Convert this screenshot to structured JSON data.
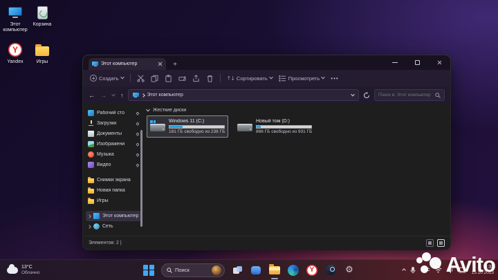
{
  "desktop": {
    "icons": [
      {
        "label": "Этот компьютер"
      },
      {
        "label": "Корзина"
      },
      {
        "label": "Yandex"
      },
      {
        "label": "Игры"
      }
    ]
  },
  "window": {
    "tab": {
      "title": "Этот компьютер"
    },
    "toolbar": {
      "new_label": "Создать",
      "sort_label": "Сортировать",
      "view_label": "Просмотреть",
      "more_label": "•••",
      "sort_glyph": "↑↓"
    },
    "address": {
      "breadcrumb": "Этот компьютер",
      "search_placeholder": "Поиск в: Этот компьютер"
    },
    "sidebar": {
      "pinned": [
        {
          "label": "Рабочий сто"
        },
        {
          "label": "Загрузки"
        },
        {
          "label": "Документы"
        },
        {
          "label": "Изображени"
        },
        {
          "label": "Музыка"
        },
        {
          "label": "Видео"
        }
      ],
      "folders": [
        {
          "label": "Снимки экрана"
        },
        {
          "label": "Новая папка"
        },
        {
          "label": "Игры"
        }
      ],
      "tree": [
        {
          "label": "Этот компьютер"
        },
        {
          "label": "Сеть"
        }
      ]
    },
    "content": {
      "group_label": "Жесткие диски",
      "drives": [
        {
          "name": "Windows 11 (C:)",
          "caption": "181 ГБ свободно из 238 ГБ",
          "used_pct": 24
        },
        {
          "name": "Новый том (D:)",
          "caption": "866 ГБ свободно из 931 ГБ",
          "used_pct": 7
        }
      ]
    },
    "statusbar": {
      "items_label": "Элементов: 2  |"
    }
  },
  "taskbar": {
    "weather": {
      "temp": "13°C",
      "condition": "Облачно"
    },
    "search_label": "Поиск",
    "yandex_letter": "Y",
    "tray": {
      "lang": "РУС",
      "time": "9:33",
      "date": "15.10.2023"
    }
  },
  "watermark": {
    "brand": "Avito"
  },
  "colors": {
    "accent": "#26a0da",
    "folder": "#f0ad36",
    "yandex_red": "#e5261f"
  }
}
